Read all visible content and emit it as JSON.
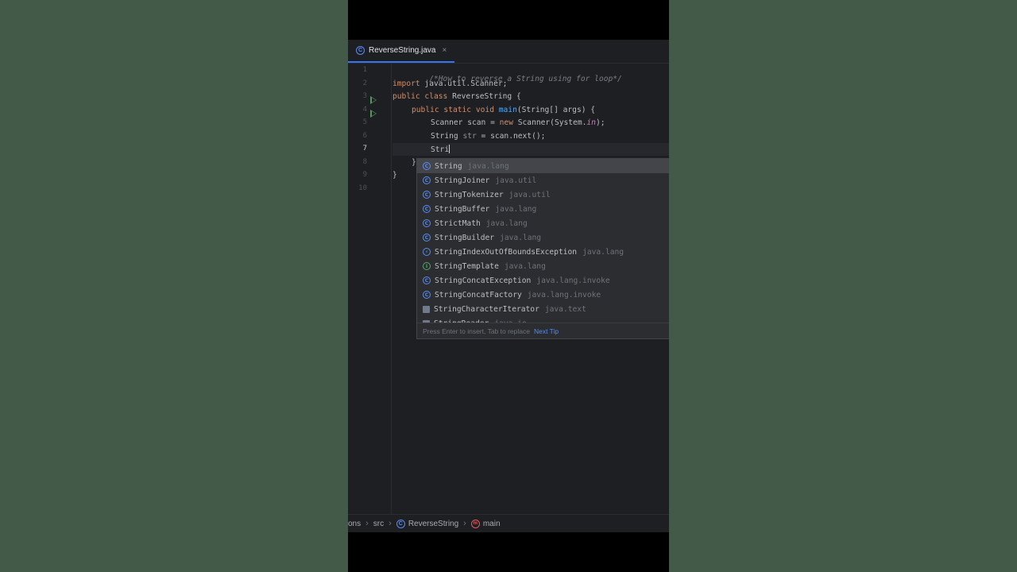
{
  "editor": {
    "tab": {
      "label": "ReverseString.java",
      "icon": "java-class-icon",
      "close": "×"
    },
    "current_line": 7,
    "line_numbers": [
      "1",
      "2",
      "3",
      "4",
      "5",
      "6",
      "7",
      "8",
      "9",
      "10"
    ],
    "lines": {
      "l1": "/*How to reverse a String using for loop*/",
      "l2_kw": "import",
      "l2_rest": " java.util.Scanner;",
      "l3_kw": "public class",
      "l3_rest": " ReverseString {",
      "l4_kw": "public static void",
      "l4_fn": "main",
      "l4_rest": "(String[] args) {",
      "l5_a": "Scanner scan = ",
      "l5_kw": "new",
      "l5_b": " Scanner(System.",
      "l5_in": "in",
      "l5_c": ");",
      "l6_a": "String ",
      "l6_var": "str",
      "l6_b": " = scan.next();",
      "l7": "Stri",
      "l8": "}",
      "l9": "}"
    }
  },
  "completion": {
    "items": [
      {
        "name": "String",
        "pkg": "java.lang",
        "icon": "class-icon"
      },
      {
        "name": "StringJoiner",
        "pkg": "java.util",
        "icon": "class-icon"
      },
      {
        "name": "StringTokenizer",
        "pkg": "java.util",
        "icon": "class-icon"
      },
      {
        "name": "StringBuffer",
        "pkg": "java.lang",
        "icon": "class-icon"
      },
      {
        "name": "StrictMath",
        "pkg": "java.lang",
        "icon": "class-icon"
      },
      {
        "name": "StringBuilder",
        "pkg": "java.lang",
        "icon": "class-icon"
      },
      {
        "name": "StringIndexOutOfBoundsException",
        "pkg": "java.lang",
        "icon": "exception-class-icon"
      },
      {
        "name": "StringTemplate",
        "pkg": "java.lang",
        "icon": "interface-icon"
      },
      {
        "name": "StringConcatException",
        "pkg": "java.lang.invoke",
        "icon": "class-icon"
      },
      {
        "name": "StringConcatFactory",
        "pkg": "java.lang.invoke",
        "icon": "class-icon"
      },
      {
        "name": "StringCharacterIterator",
        "pkg": "java.text",
        "icon": "abstract-class-icon"
      },
      {
        "name": "StringReader",
        "pkg": "java.io",
        "icon": "abstract-class-icon"
      }
    ],
    "hint": "Press Enter to insert, Tab to replace",
    "next_tip": "Next Tip"
  },
  "breadcrumb": {
    "part1": "ons",
    "part2": "src",
    "part3": "ReverseString",
    "part4": "main",
    "sep": "›"
  },
  "colors": {
    "background": "#445a49",
    "editor_bg": "#1e1f22",
    "popup_bg": "#2b2d30",
    "keyword": "#cf8e6d",
    "function": "#56a8f5",
    "accent": "#3574f0"
  }
}
